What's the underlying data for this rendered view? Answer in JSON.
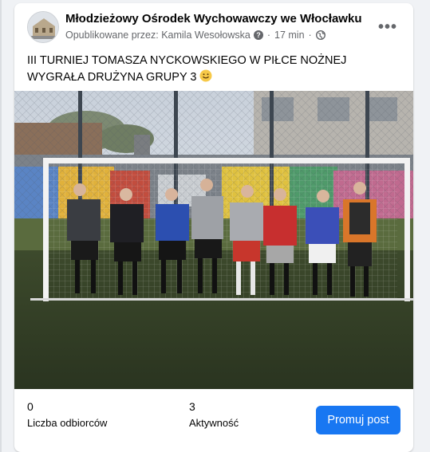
{
  "post": {
    "page_name": "Młodzieżowy Ośrodek Wychowawczy we Włocławku",
    "published_by": "Opublikowane przez: Kamila Wesołowska",
    "time": "17 min",
    "text": "III TURNIEJ TOMASZA NYCKOWSKIEGO W PIŁCE NOŻNEJ WYGRAŁA DRUŻYNA GRUPY 3",
    "emoji": "slightly-smiling-face-icon"
  },
  "stats": {
    "reach_value": "0",
    "reach_label": "Liczba odbiorców",
    "engagement_value": "3",
    "engagement_label": "Aktywność"
  },
  "actions": {
    "promote_label": "Promuj post",
    "more_label": "•••"
  },
  "colors": {
    "accent": "#1877f2",
    "secondary_text": "#65676b"
  }
}
